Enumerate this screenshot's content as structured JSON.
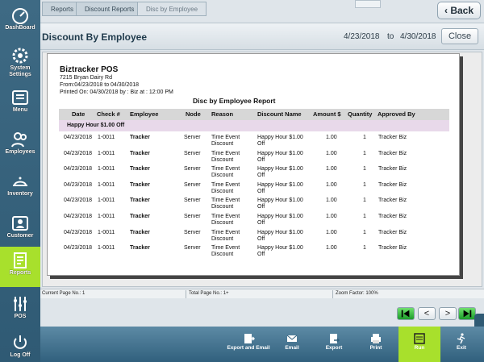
{
  "sidebar": {
    "items": [
      {
        "label": "DashBoard",
        "icon": "dashboard-icon"
      },
      {
        "label": "System Settings",
        "icon": "gear-icon"
      },
      {
        "label": "Menu",
        "icon": "menu-icon"
      },
      {
        "label": "Employees",
        "icon": "employees-icon"
      },
      {
        "label": "Inventory",
        "icon": "inventory-icon"
      },
      {
        "label": "Customer",
        "icon": "customer-icon"
      },
      {
        "label": "Reports",
        "icon": "reports-icon"
      },
      {
        "label": "POS",
        "icon": "pos-icon"
      },
      {
        "label": "Log Off",
        "icon": "power-icon"
      }
    ],
    "active": "Reports",
    "colors": {
      "bg": "#2f5a74",
      "active": "#a8e02c"
    }
  },
  "breadcrumb": {
    "items": [
      "Reports",
      "Discount Reports",
      "Disc by Employee"
    ]
  },
  "back_label": "Back",
  "header": {
    "title": "Discount By Employee",
    "date_from": "4/23/2018",
    "to_label": "to",
    "date_to": "4/30/2018",
    "close_label": "Close"
  },
  "report": {
    "company": "Biztracker POS",
    "address": "7215 Bryan Dairy Rd",
    "from_line": "From:04/23/2018  to 04/30/2018",
    "printed_line": "Printed On: 04/30/2018 by : Biz  at : 12:00 PM",
    "title": "Disc by Employee Report",
    "columns": [
      "Date",
      "Check #",
      "Employee",
      "Node",
      "Reason",
      "Discount Name",
      "Amount $",
      "Quantity",
      "Approved By"
    ],
    "group": "Happy Hour $1.00 Off",
    "rows": [
      {
        "date": "04/23/2018",
        "check": "1-0011",
        "employee": "Tracker",
        "node": "Server",
        "reason1": "Time Event",
        "reason2": "Discount",
        "disc1": "Happy Hour $1.00",
        "disc2": "Off",
        "amount": "1.00",
        "qty": "1",
        "approved": "Tracker Biz"
      },
      {
        "date": "04/23/2018",
        "check": "1-0011",
        "employee": "Tracker",
        "node": "Server",
        "reason1": "Time Event",
        "reason2": "Discount",
        "disc1": "Happy Hour $1.00",
        "disc2": "Off",
        "amount": "1.00",
        "qty": "1",
        "approved": "Tracker Biz"
      },
      {
        "date": "04/23/2018",
        "check": "1-0011",
        "employee": "Tracker",
        "node": "Server",
        "reason1": "Time Event",
        "reason2": "Discount",
        "disc1": "Happy Hour $1.00",
        "disc2": "Off",
        "amount": "1.00",
        "qty": "1",
        "approved": "Tracker Biz"
      },
      {
        "date": "04/23/2018",
        "check": "1-0011",
        "employee": "Tracker",
        "node": "Server",
        "reason1": "Time Event",
        "reason2": "Discount",
        "disc1": "Happy Hour $1.00",
        "disc2": "Off",
        "amount": "1.00",
        "qty": "1",
        "approved": "Tracker Biz"
      },
      {
        "date": "04/23/2018",
        "check": "1-0011",
        "employee": "Tracker",
        "node": "Server",
        "reason1": "Time Event",
        "reason2": "Discount",
        "disc1": "Happy Hour $1.00",
        "disc2": "Off",
        "amount": "1.00",
        "qty": "1",
        "approved": "Tracker Biz"
      },
      {
        "date": "04/23/2018",
        "check": "1-0011",
        "employee": "Tracker",
        "node": "Server",
        "reason1": "Time Event",
        "reason2": "Discount",
        "disc1": "Happy Hour $1.00",
        "disc2": "Off",
        "amount": "1.00",
        "qty": "1",
        "approved": "Tracker Biz"
      },
      {
        "date": "04/23/2018",
        "check": "1-0011",
        "employee": "Tracker",
        "node": "Server",
        "reason1": "Time Event",
        "reason2": "Discount",
        "disc1": "Happy Hour $1.00",
        "disc2": "Off",
        "amount": "1.00",
        "qty": "1",
        "approved": "Tracker Biz"
      },
      {
        "date": "04/23/2018",
        "check": "1-0011",
        "employee": "Tracker",
        "node": "Server",
        "reason1": "Time Event",
        "reason2": "Discount",
        "disc1": "Happy Hour $1.00",
        "disc2": "Off",
        "amount": "1.00",
        "qty": "1",
        "approved": "Tracker Biz"
      }
    ]
  },
  "status": {
    "current_page": "Current Page No.: 1",
    "total_page": "Total Page No.: 1+",
    "zoom": "Zoom Factor: 100%"
  },
  "navigation": {
    "first": "first-page-icon",
    "prev": "<",
    "next": ">",
    "last": "last-page-icon"
  },
  "toolbar": {
    "buttons": [
      {
        "label": "Export and Email",
        "icon": "export-email-icon"
      },
      {
        "label": "Email",
        "icon": "email-icon"
      },
      {
        "label": "Export",
        "icon": "export-icon"
      },
      {
        "label": "Print",
        "icon": "print-icon"
      },
      {
        "label": "Run",
        "icon": "run-icon"
      },
      {
        "label": "Exit",
        "icon": "exit-icon"
      }
    ],
    "colors": {
      "bg": "#31607d",
      "run": "#a8e02c"
    }
  }
}
